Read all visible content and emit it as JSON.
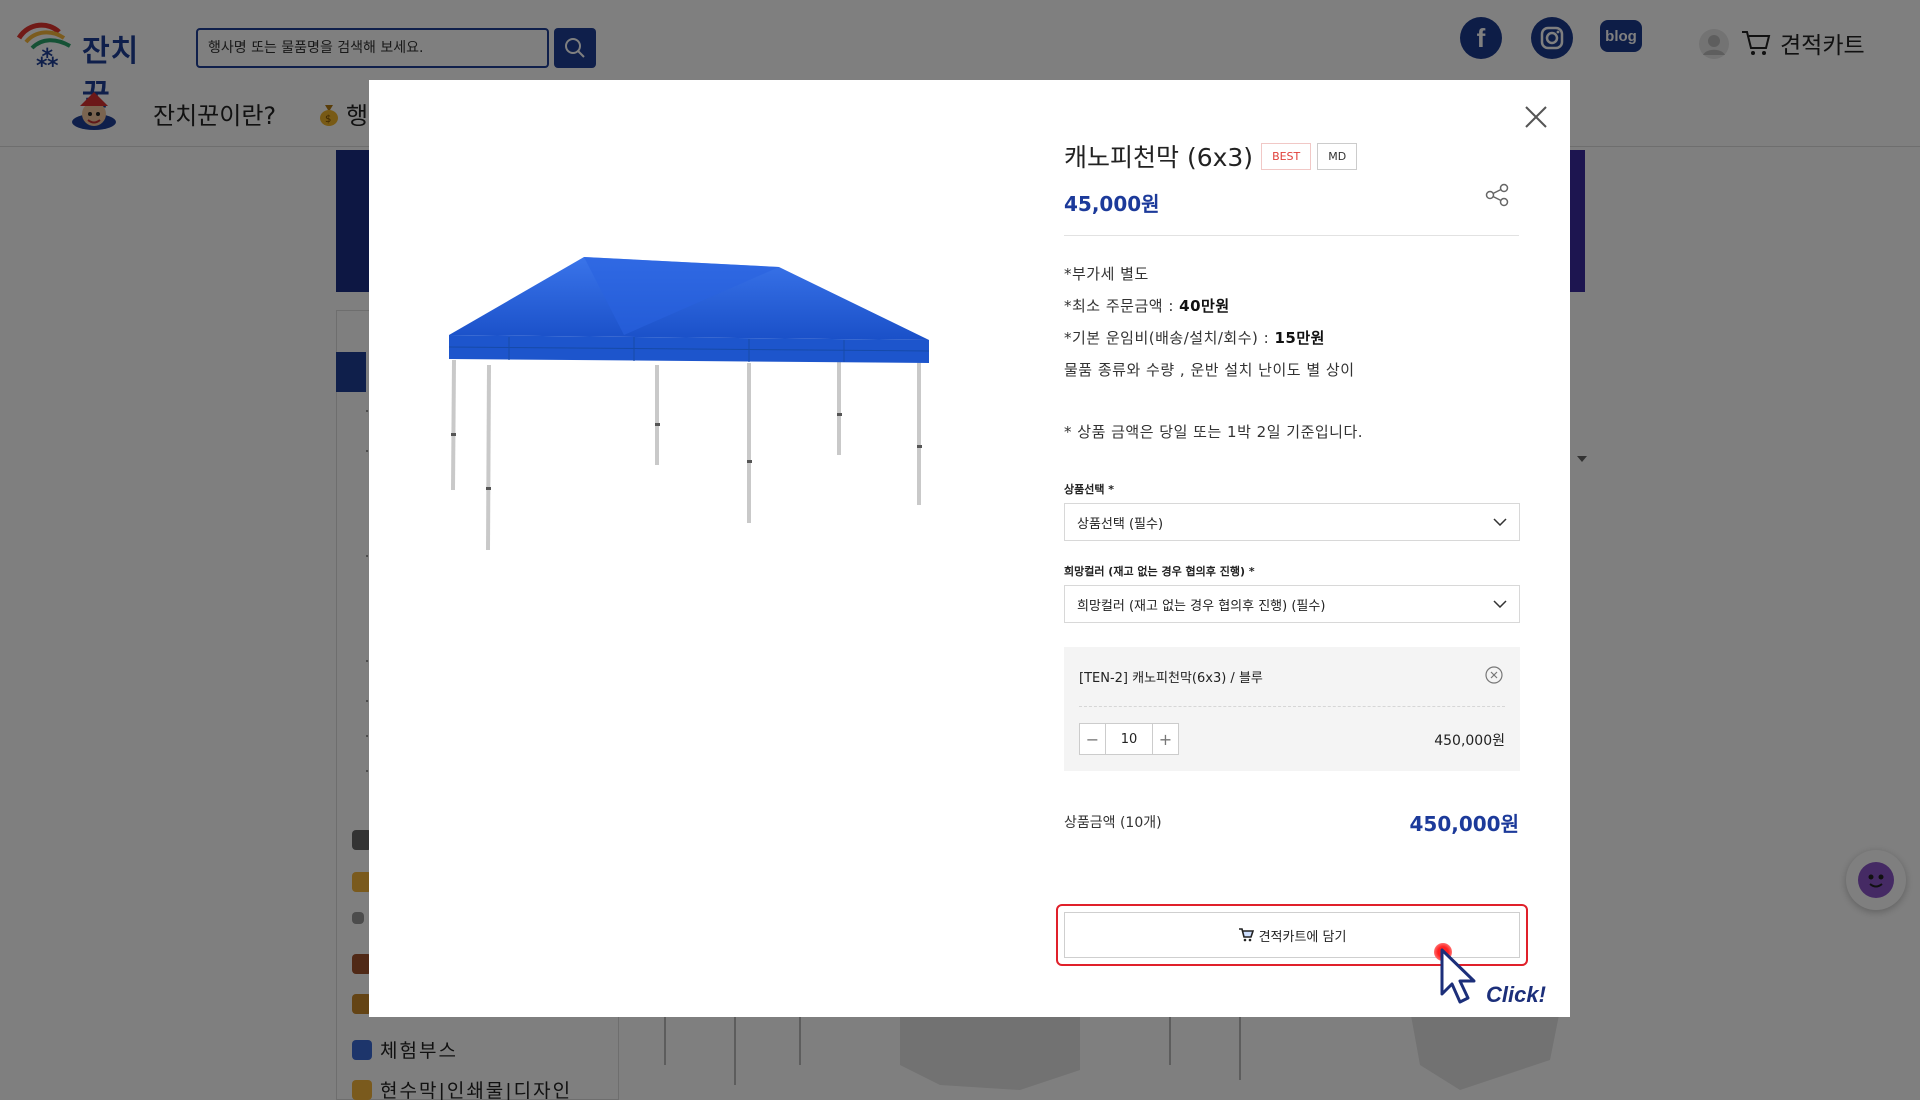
{
  "header": {
    "logo_text": "잔치꾼",
    "search_placeholder": "행사명 또는 물품명을 검색해 보세요.",
    "social": {
      "facebook": "f",
      "blog": "blog"
    },
    "cart_label": "견적카트"
  },
  "nav": {
    "items": [
      {
        "label": "잔치꾼이란?"
      },
      {
        "label": "행"
      }
    ]
  },
  "sidebar": {
    "categories": [
      {
        "label": "체험부스"
      },
      {
        "label": "현수막|인쇄물|디자인"
      }
    ]
  },
  "product": {
    "title": "캐노피천막 (6x3)",
    "badges": [
      "BEST",
      "MD"
    ],
    "price": "45,000원",
    "notes": {
      "n1": "*부가세 별도",
      "n2_prefix": "*최소 주문금액 : ",
      "n2_value": "40만원",
      "n3_prefix": "*기본 운임비(배송/설치/회수) : ",
      "n3_value": "15만원",
      "n4": "물품 종류와 수량 , 운반 설치 난이도 별 상이",
      "n5": "* 상품 금액은 당일 또는 1박 2일 기준입니다."
    },
    "options": {
      "product_select_label": "상품선택 *",
      "product_select_value": "상품선택 (필수)",
      "color_select_label": "희망컬러 (재고 없는 경우 협의후 진행) *",
      "color_select_value": "희망컬러 (재고 없는 경우 협의후 진행) (필수)"
    },
    "selected_option": {
      "name": "[TEN-2] 캐노피천막(6x3) / 블루",
      "quantity": "10",
      "minus": "−",
      "plus": "+",
      "price": "450,000원"
    },
    "total": {
      "label": "상품금액 (10개)",
      "price": "450,000원"
    },
    "cart_button_label": "견적카트에 담기"
  },
  "annotation": {
    "click_text": "Click!",
    "highlight_color": "#e0202a"
  },
  "colors": {
    "brand": "#1e3f96",
    "price": "#1c3a9a",
    "badge_best": "#e0403a",
    "tent": "#1f5bd6"
  }
}
